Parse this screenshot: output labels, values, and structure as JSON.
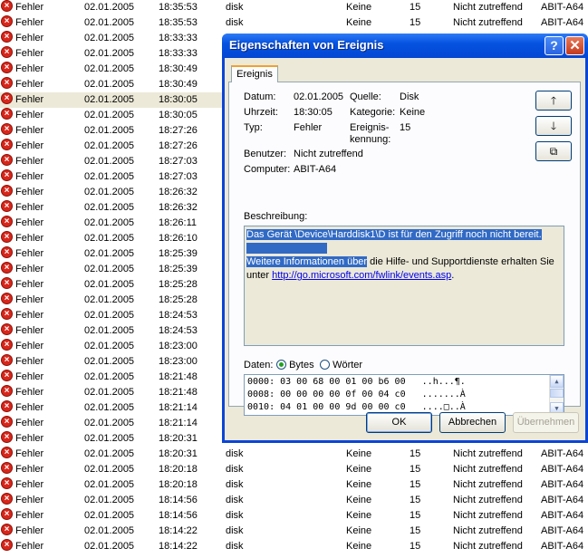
{
  "events": [
    {
      "type": "Fehler",
      "date": "02.01.2005",
      "time": "18:35:53",
      "source": "disk",
      "category": "Keine",
      "id": "15",
      "user": "Nicht zutreffend",
      "computer": "ABIT-A64"
    },
    {
      "type": "Fehler",
      "date": "02.01.2005",
      "time": "18:35:53",
      "source": "disk",
      "category": "Keine",
      "id": "15",
      "user": "Nicht zutreffend",
      "computer": "ABIT-A64"
    },
    {
      "type": "Fehler",
      "date": "02.01.2005",
      "time": "18:33:33",
      "source": "",
      "category": "",
      "id": "",
      "user": "",
      "computer": ""
    },
    {
      "type": "Fehler",
      "date": "02.01.2005",
      "time": "18:33:33",
      "source": "",
      "category": "",
      "id": "",
      "user": "",
      "computer": ""
    },
    {
      "type": "Fehler",
      "date": "02.01.2005",
      "time": "18:30:49",
      "source": "",
      "category": "",
      "id": "",
      "user": "",
      "computer": ""
    },
    {
      "type": "Fehler",
      "date": "02.01.2005",
      "time": "18:30:49",
      "source": "",
      "category": "",
      "id": "",
      "user": "",
      "computer": ""
    },
    {
      "type": "Fehler",
      "date": "02.01.2005",
      "time": "18:30:05",
      "source": "",
      "category": "",
      "id": "",
      "user": "",
      "computer": ""
    },
    {
      "type": "Fehler",
      "date": "02.01.2005",
      "time": "18:30:05",
      "source": "",
      "category": "",
      "id": "",
      "user": "",
      "computer": ""
    },
    {
      "type": "Fehler",
      "date": "02.01.2005",
      "time": "18:27:26",
      "source": "",
      "category": "",
      "id": "",
      "user": "",
      "computer": ""
    },
    {
      "type": "Fehler",
      "date": "02.01.2005",
      "time": "18:27:26",
      "source": "",
      "category": "",
      "id": "",
      "user": "",
      "computer": ""
    },
    {
      "type": "Fehler",
      "date": "02.01.2005",
      "time": "18:27:03",
      "source": "",
      "category": "",
      "id": "",
      "user": "",
      "computer": ""
    },
    {
      "type": "Fehler",
      "date": "02.01.2005",
      "time": "18:27:03",
      "source": "",
      "category": "",
      "id": "",
      "user": "",
      "computer": ""
    },
    {
      "type": "Fehler",
      "date": "02.01.2005",
      "time": "18:26:32",
      "source": "",
      "category": "",
      "id": "",
      "user": "",
      "computer": ""
    },
    {
      "type": "Fehler",
      "date": "02.01.2005",
      "time": "18:26:32",
      "source": "",
      "category": "",
      "id": "",
      "user": "",
      "computer": ""
    },
    {
      "type": "Fehler",
      "date": "02.01.2005",
      "time": "18:26:11",
      "source": "",
      "category": "",
      "id": "",
      "user": "",
      "computer": ""
    },
    {
      "type": "Fehler",
      "date": "02.01.2005",
      "time": "18:26:10",
      "source": "",
      "category": "",
      "id": "",
      "user": "",
      "computer": ""
    },
    {
      "type": "Fehler",
      "date": "02.01.2005",
      "time": "18:25:39",
      "source": "",
      "category": "",
      "id": "",
      "user": "",
      "computer": ""
    },
    {
      "type": "Fehler",
      "date": "02.01.2005",
      "time": "18:25:39",
      "source": "",
      "category": "",
      "id": "",
      "user": "",
      "computer": ""
    },
    {
      "type": "Fehler",
      "date": "02.01.2005",
      "time": "18:25:28",
      "source": "",
      "category": "",
      "id": "",
      "user": "",
      "computer": ""
    },
    {
      "type": "Fehler",
      "date": "02.01.2005",
      "time": "18:25:28",
      "source": "",
      "category": "",
      "id": "",
      "user": "",
      "computer": ""
    },
    {
      "type": "Fehler",
      "date": "02.01.2005",
      "time": "18:24:53",
      "source": "",
      "category": "",
      "id": "",
      "user": "",
      "computer": ""
    },
    {
      "type": "Fehler",
      "date": "02.01.2005",
      "time": "18:24:53",
      "source": "",
      "category": "",
      "id": "",
      "user": "",
      "computer": ""
    },
    {
      "type": "Fehler",
      "date": "02.01.2005",
      "time": "18:23:00",
      "source": "",
      "category": "",
      "id": "",
      "user": "",
      "computer": ""
    },
    {
      "type": "Fehler",
      "date": "02.01.2005",
      "time": "18:23:00",
      "source": "",
      "category": "",
      "id": "",
      "user": "",
      "computer": ""
    },
    {
      "type": "Fehler",
      "date": "02.01.2005",
      "time": "18:21:48",
      "source": "",
      "category": "",
      "id": "",
      "user": "",
      "computer": ""
    },
    {
      "type": "Fehler",
      "date": "02.01.2005",
      "time": "18:21:48",
      "source": "",
      "category": "",
      "id": "",
      "user": "",
      "computer": ""
    },
    {
      "type": "Fehler",
      "date": "02.01.2005",
      "time": "18:21:14",
      "source": "",
      "category": "",
      "id": "",
      "user": "",
      "computer": ""
    },
    {
      "type": "Fehler",
      "date": "02.01.2005",
      "time": "18:21:14",
      "source": "",
      "category": "",
      "id": "",
      "user": "",
      "computer": ""
    },
    {
      "type": "Fehler",
      "date": "02.01.2005",
      "time": "18:20:31",
      "source": "",
      "category": "",
      "id": "",
      "user": "",
      "computer": ""
    },
    {
      "type": "Fehler",
      "date": "02.01.2005",
      "time": "18:20:31",
      "source": "disk",
      "category": "Keine",
      "id": "15",
      "user": "Nicht zutreffend",
      "computer": "ABIT-A64"
    },
    {
      "type": "Fehler",
      "date": "02.01.2005",
      "time": "18:20:18",
      "source": "disk",
      "category": "Keine",
      "id": "15",
      "user": "Nicht zutreffend",
      "computer": "ABIT-A64"
    },
    {
      "type": "Fehler",
      "date": "02.01.2005",
      "time": "18:20:18",
      "source": "disk",
      "category": "Keine",
      "id": "15",
      "user": "Nicht zutreffend",
      "computer": "ABIT-A64"
    },
    {
      "type": "Fehler",
      "date": "02.01.2005",
      "time": "18:14:56",
      "source": "disk",
      "category": "Keine",
      "id": "15",
      "user": "Nicht zutreffend",
      "computer": "ABIT-A64"
    },
    {
      "type": "Fehler",
      "date": "02.01.2005",
      "time": "18:14:56",
      "source": "disk",
      "category": "Keine",
      "id": "15",
      "user": "Nicht zutreffend",
      "computer": "ABIT-A64"
    },
    {
      "type": "Fehler",
      "date": "02.01.2005",
      "time": "18:14:22",
      "source": "disk",
      "category": "Keine",
      "id": "15",
      "user": "Nicht zutreffend",
      "computer": "ABIT-A64"
    },
    {
      "type": "Fehler",
      "date": "02.01.2005",
      "time": "18:14:22",
      "source": "disk",
      "category": "Keine",
      "id": "15",
      "user": "Nicht zutreffend",
      "computer": "ABIT-A64"
    }
  ],
  "selected_row": 6,
  "error_icon": "error-icon",
  "dialog": {
    "title": "Eigenschaften von Ereignis",
    "help_label": "?",
    "close_label": "✕",
    "tab": "Ereignis",
    "fields": {
      "datum_label": "Datum:",
      "datum": "02.01.2005",
      "quelle_label": "Quelle:",
      "quelle": "Disk",
      "uhrzeit_label": "Uhrzeit:",
      "uhrzeit": "18:30:05",
      "kategorie_label": "Kategorie:",
      "kategorie": "Keine",
      "typ_label": "Typ:",
      "typ": "Fehler",
      "kennung_label_1": "Ereignis-",
      "kennung_label_2": "kennung:",
      "kennung": "15",
      "benutzer_label": "Benutzer:",
      "benutzer": "Nicht zutreffend",
      "computer_label": "Computer:",
      "computer": "ABIT-A64"
    },
    "nav": {
      "up": "🡑",
      "down": "🡓",
      "copy": "⧉"
    },
    "description_label": "Beschreibung:",
    "description": {
      "line1": "Das Gerät \\Device\\Harddisk1\\D ist für den Zugriff noch nicht bereit.",
      "line2_selected": "Weitere Informationen über",
      "line2_rest": " die Hilfe- und Supportdienste erhalten Sie",
      "line3_prefix": "unter ",
      "link": "http://go.microsoft.com/fwlink/events.asp",
      "line3_suffix": "."
    },
    "data_label": "Daten:",
    "radio_bytes": "Bytes",
    "radio_words": "Wörter",
    "data_format": "Bytes",
    "hex_lines": [
      "0000: 03 00 68 00 01 00 b6 00   ..h...¶.",
      "0008: 00 00 00 00 0f 00 04 c0   .......À",
      "0010: 04 01 00 00 9d 00 00 c0   ....□..À"
    ],
    "buttons": {
      "ok": "OK",
      "cancel": "Abbrechen",
      "apply": "Übernehmen"
    },
    "colors": {
      "titlebar": "#0553e0",
      "selection": "#316ac5",
      "close": "#c53a1c"
    }
  }
}
